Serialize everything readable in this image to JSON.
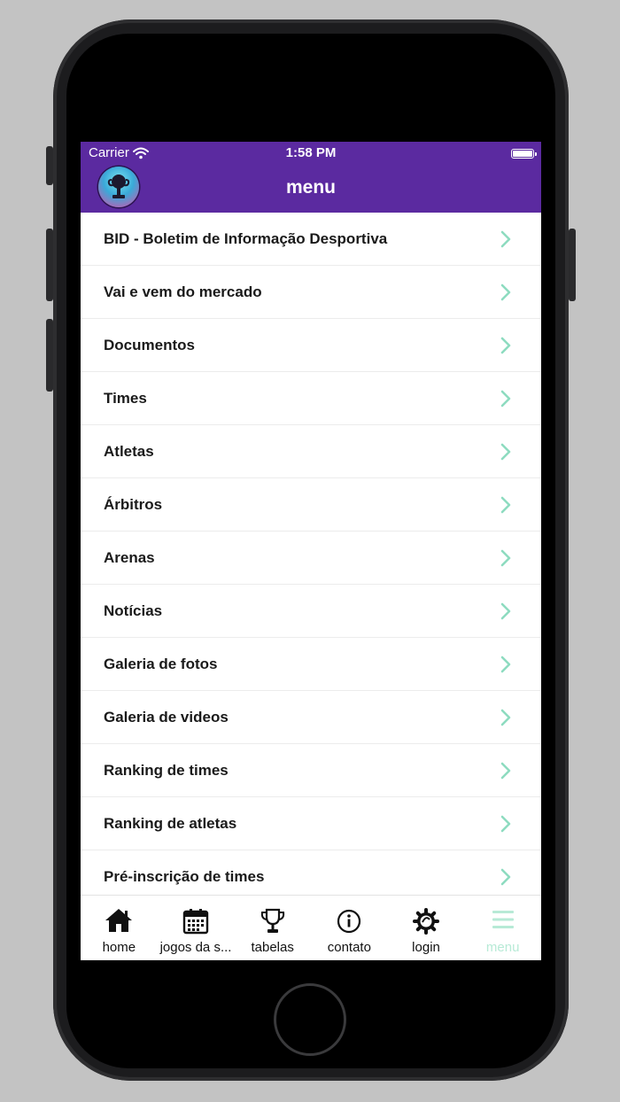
{
  "status_bar": {
    "carrier": "Carrier",
    "time": "1:58 PM"
  },
  "header": {
    "title": "menu",
    "bg_color": "#5b2aa0"
  },
  "menu": {
    "chevron_color": "#8edcc0",
    "items": [
      {
        "label": "BID - Boletim de Informação Desportiva"
      },
      {
        "label": "Vai e vem do mercado"
      },
      {
        "label": "Documentos"
      },
      {
        "label": "Times"
      },
      {
        "label": "Atletas"
      },
      {
        "label": "Árbitros"
      },
      {
        "label": "Arenas"
      },
      {
        "label": "Notícias"
      },
      {
        "label": "Galeria de fotos"
      },
      {
        "label": "Galeria de videos"
      },
      {
        "label": "Ranking de times"
      },
      {
        "label": "Ranking de atletas"
      },
      {
        "label": "Pré-inscrição de times"
      }
    ]
  },
  "tab_bar": {
    "active_color": "#b7ead6",
    "tabs": [
      {
        "label": "home",
        "icon": "home-icon"
      },
      {
        "label": "jogos da s...",
        "icon": "calendar-icon"
      },
      {
        "label": "tabelas",
        "icon": "trophy-icon"
      },
      {
        "label": "contato",
        "icon": "info-icon"
      },
      {
        "label": "login",
        "icon": "gear-icon"
      },
      {
        "label": "menu",
        "icon": "menu-icon",
        "active": true
      }
    ]
  }
}
